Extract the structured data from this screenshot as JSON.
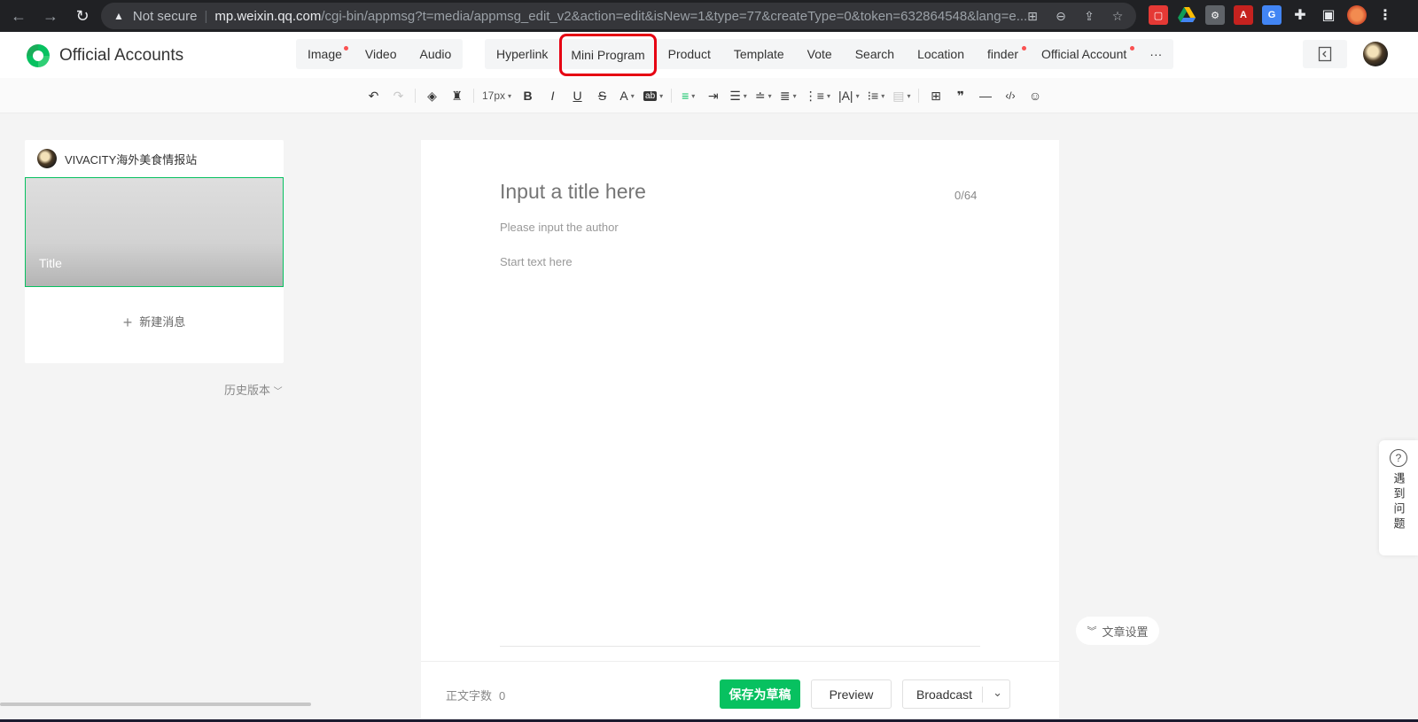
{
  "browser": {
    "security_label": "Not secure",
    "url_host": "mp.weixin.qq.com",
    "url_path": "/cgi-bin/appmsg?t=media/appmsg_edit_v2&action=edit&isNew=1&type=77&createType=0&token=632864548&lang=e..."
  },
  "app": {
    "brand": "Official Accounts",
    "brand_color": "#07c160",
    "insert_menu_media": [
      {
        "label": "Image",
        "dot": true
      },
      {
        "label": "Video",
        "dot": false
      },
      {
        "label": "Audio",
        "dot": false
      }
    ],
    "insert_menu_links": [
      {
        "label": "Hyperlink"
      },
      {
        "label": "Mini Program"
      },
      {
        "label": "Product"
      },
      {
        "label": "Template"
      },
      {
        "label": "Vote"
      },
      {
        "label": "Search"
      },
      {
        "label": "Location"
      },
      {
        "label": "finder"
      },
      {
        "label": "Official Account"
      },
      {
        "label": "···"
      }
    ],
    "highlight_color": "#e60012"
  },
  "toolbar": {
    "font_size": "17px"
  },
  "sidebar": {
    "account_name": "VIVACITY海外美食情报站",
    "cover_title": "Title",
    "new_message": "新建消息",
    "history": "历史版本"
  },
  "editor": {
    "title_placeholder": "Input a title here",
    "title_count": "0/64",
    "author_placeholder": "Please input the author",
    "body_placeholder": "Start text here",
    "word_count_label": "正文字数",
    "word_count": "0",
    "save_draft": "保存为草稿",
    "preview": "Preview",
    "broadcast": "Broadcast"
  },
  "side": {
    "article_settings": "文章设置",
    "help": "遇到问题"
  }
}
